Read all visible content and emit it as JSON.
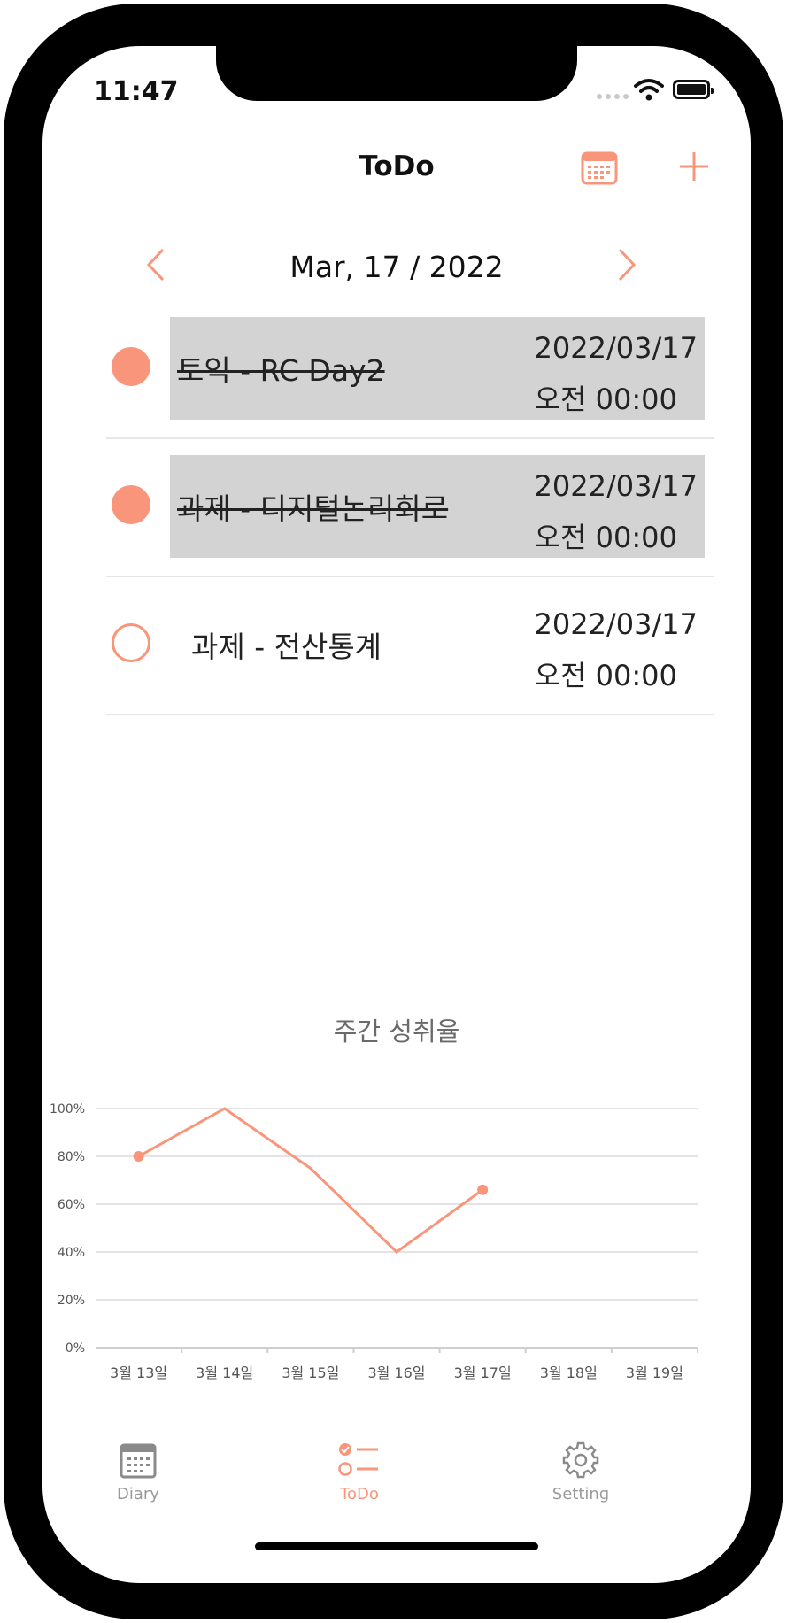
{
  "status_bar": {
    "time": "11:47"
  },
  "nav": {
    "title": "ToDo",
    "calendar_icon": "calendar-icon",
    "add_icon": "plus-icon"
  },
  "date_nav": {
    "label": "Mar, 17 / 2022"
  },
  "todos": [
    {
      "title": "토익 - RC Day2",
      "date": "2022/03/17",
      "time": "오전 00:00",
      "done": true
    },
    {
      "title": "과제 - 디지털논리회로",
      "date": "2022/03/17",
      "time": "오전 00:00",
      "done": true
    },
    {
      "title": "과제 - 전산통계",
      "date": "2022/03/17",
      "time": "오전 00:00",
      "done": false
    }
  ],
  "chart_data": {
    "type": "line",
    "title": "주간 성취율",
    "categories": [
      "3월 13일",
      "3월 14일",
      "3월 15일",
      "3월 16일",
      "3월 17일",
      "3월 18일",
      "3월 19일"
    ],
    "values": [
      80,
      100,
      75,
      40,
      66,
      null,
      null
    ],
    "ylim": [
      0,
      100
    ],
    "yticks": [
      "0%",
      "20%",
      "40%",
      "60%",
      "80%",
      "100%"
    ],
    "color": "#f8957a",
    "grid": true
  },
  "tabs": [
    {
      "label": "Diary",
      "icon": "calendar-icon",
      "active": false
    },
    {
      "label": "ToDo",
      "icon": "checklist-icon",
      "active": true
    },
    {
      "label": "Setting",
      "icon": "gear-icon",
      "active": false
    }
  ],
  "accent_color": "#f8957a"
}
